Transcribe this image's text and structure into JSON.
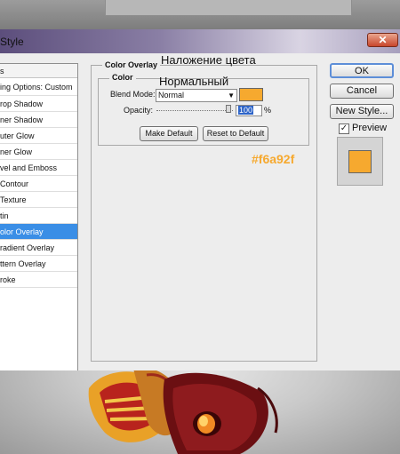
{
  "window": {
    "title": "Style"
  },
  "styles_panel": {
    "header": "s",
    "blending_options": "ing Options: Custom",
    "items": [
      {
        "label": "rop Shadow",
        "selected": false
      },
      {
        "label": "ner Shadow",
        "selected": false
      },
      {
        "label": "uter Glow",
        "selected": false
      },
      {
        "label": "ner Glow",
        "selected": false
      },
      {
        "label": "vel and Emboss",
        "selected": false
      },
      {
        "label": " Contour",
        "selected": false
      },
      {
        "label": " Texture",
        "selected": false
      },
      {
        "label": "tin",
        "selected": false
      },
      {
        "label": "olor Overlay",
        "selected": true
      },
      {
        "label": "radient Overlay",
        "selected": false
      },
      {
        "label": "ttern Overlay",
        "selected": false
      },
      {
        "label": "roke",
        "selected": false
      }
    ]
  },
  "color_overlay": {
    "group_title": "Color Overlay",
    "subgroup_title": "Color",
    "blend_mode_label": "Blend Mode:",
    "blend_mode_value": "Normal",
    "swatch_color": "#f6a92f",
    "opacity_label": "Opacity:",
    "opacity_value": "100",
    "opacity_unit": "%",
    "opacity_level": 1.0,
    "make_default": "Make Default",
    "reset_to_default": "Reset to Default"
  },
  "side_buttons": {
    "ok": "OK",
    "cancel": "Cancel",
    "new_style": "New Style...",
    "preview_label": "Preview",
    "preview_checked": true,
    "preview_color": "#f6a92f"
  },
  "annotations": {
    "title_ru": "Наложение цвета",
    "blend_ru": "Нормальный",
    "hex": "#f6a92f",
    "hex_color": "#f6a92f"
  },
  "colors": {
    "accent": "#3a8ee6",
    "overlay_orange": "#f6a92f"
  },
  "icons": {
    "close": "close-icon",
    "checkmark": "checkmark-icon",
    "dropdown": "chevron-down-icon"
  }
}
